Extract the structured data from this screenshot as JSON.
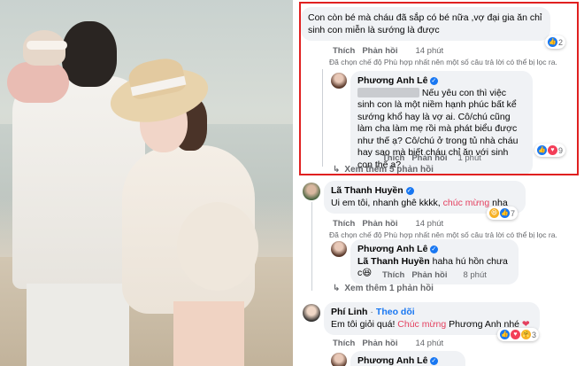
{
  "comments": [
    {
      "text": "Con còn bé mà cháu đã sắp có bé nữa ,vợ đại gia ăn chỉ sinh con miễn là sướng là được",
      "like": "Thích",
      "reply": "Phản hồi",
      "time": "14 phút",
      "react_count": "2",
      "mode_note": "Đã chọn chế độ Phù hợp nhất nên một số câu trả lời có thể bị lọc ra."
    },
    {
      "name": "Phương Anh Lê",
      "text": "Nếu yêu con thì việc sinh con là một niềm hạnh phúc bất kể sướng khổ hay là vợ ai. Cô/chú cũng làm cha làm mẹ rồi mà phát biểu được như thế ạ? Cô/chú ở trong tủ nhà cháu hay sao mà biết cháu chỉ ăn với sinh con thế ạ?",
      "like": "Thích",
      "reply": "Phản hồi",
      "time": "1 phút",
      "react_count": "9"
    },
    {
      "more": "Xem thêm 5 phản hồi"
    },
    {
      "name": "Lã Thanh Huyền",
      "text_before": "Ui em tôi, nhanh ghê kkkk, ",
      "highlight": "chúc mừng",
      "text_after": " nha",
      "like": "Thích",
      "reply": "Phản hồi",
      "time": "14 phút",
      "react_count": "7",
      "mode_note": "Đã chọn chế độ Phù hợp nhất nên một số câu trả lời có thể bị lọc ra."
    },
    {
      "name": "Phương Anh Lê",
      "tag": "Lã Thanh Huyền",
      "text": " haha hú hồn chưa c",
      "like": "Thích",
      "reply": "Phản hồi",
      "time": "8 phút"
    },
    {
      "more": "Xem thêm 1 phản hồi"
    },
    {
      "name": "Phí Linh",
      "follow": "Theo dõi",
      "text_before": "Em tôi giỏi quá! ",
      "highlight": "Chúc mừng",
      "text_after": " Phương Anh nhé",
      "like": "Thích",
      "reply": "Phản hồi",
      "time": "14 phút",
      "react_count": "3"
    },
    {
      "name": "Phương Anh Lê"
    }
  ],
  "colors": {
    "highlight_box": "#e02020",
    "accent": "#1877f2",
    "mention": "#e4405f"
  }
}
